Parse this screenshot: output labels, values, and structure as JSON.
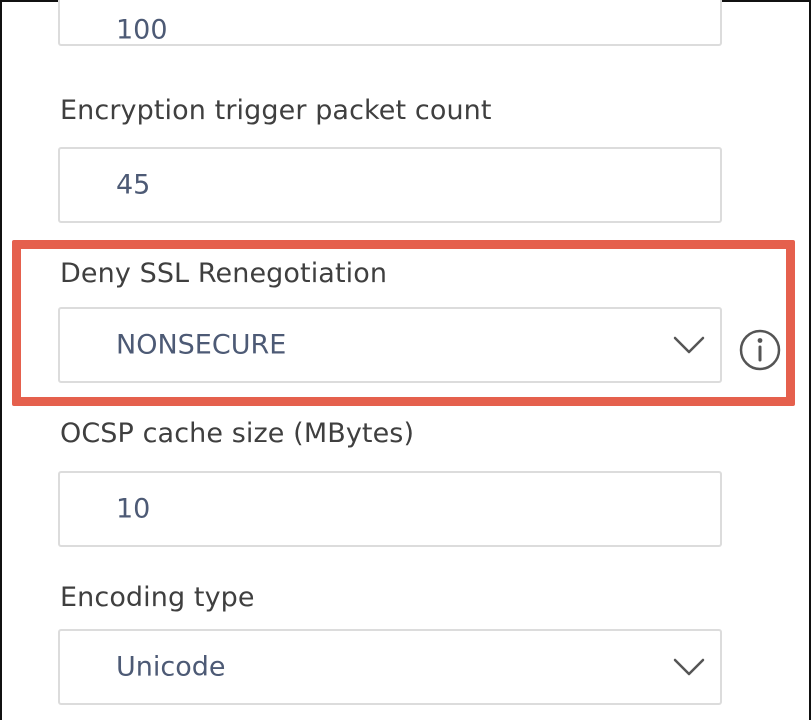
{
  "fields": {
    "previous": {
      "value": "100"
    },
    "encryption_trigger": {
      "label": "Encryption trigger packet count",
      "value": "45"
    },
    "deny_ssl": {
      "label": "Deny SSL Renegotiation",
      "value": "NONSECURE",
      "icon": "chevron-down-icon",
      "info_icon": "info-icon"
    },
    "ocsp_cache": {
      "label": "OCSP cache size (MBytes)",
      "value": "10"
    },
    "encoding_type": {
      "label": "Encoding type",
      "value": "Unicode",
      "icon": "chevron-down-icon"
    }
  },
  "colors": {
    "highlight": "#e5604d",
    "value_text": "#4d5a75",
    "label_text": "#3f3f3f",
    "field_border": "#dcdcdc"
  }
}
